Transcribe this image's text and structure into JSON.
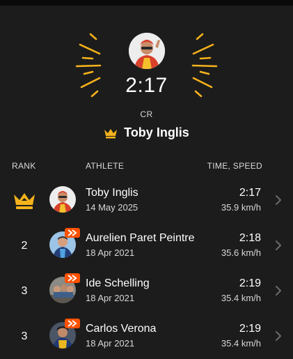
{
  "hero": {
    "time": "2:17",
    "label": "CR",
    "holder_name": "Toby Inglis",
    "accent_color": "#f5b21b"
  },
  "columns": {
    "rank": "RANK",
    "athlete": "ATHLETE",
    "time_speed": "TIME, SPEED"
  },
  "rows": [
    {
      "rank": "",
      "rank_icon": "crown-icon",
      "name": "Toby Inglis",
      "date": "14 May 2025",
      "time": "2:17",
      "speed": "35.9 km/h",
      "badge": false
    },
    {
      "rank": "2",
      "name": "Aurelien Paret Peintre",
      "date": "18 Apr 2021",
      "time": "2:18",
      "speed": "35.6 km/h",
      "badge": true
    },
    {
      "rank": "3",
      "name": "Ide Schelling",
      "date": "18 Apr 2021",
      "time": "2:19",
      "speed": "35.4 km/h",
      "badge": true
    },
    {
      "rank": "3",
      "name": "Carlos Verona",
      "date": "18 Apr 2021",
      "time": "2:19",
      "speed": "35.4 km/h",
      "badge": true
    }
  ],
  "colors": {
    "background": "#1c1c1c",
    "accent": "#f5b21b",
    "badge": "#fc5200"
  }
}
